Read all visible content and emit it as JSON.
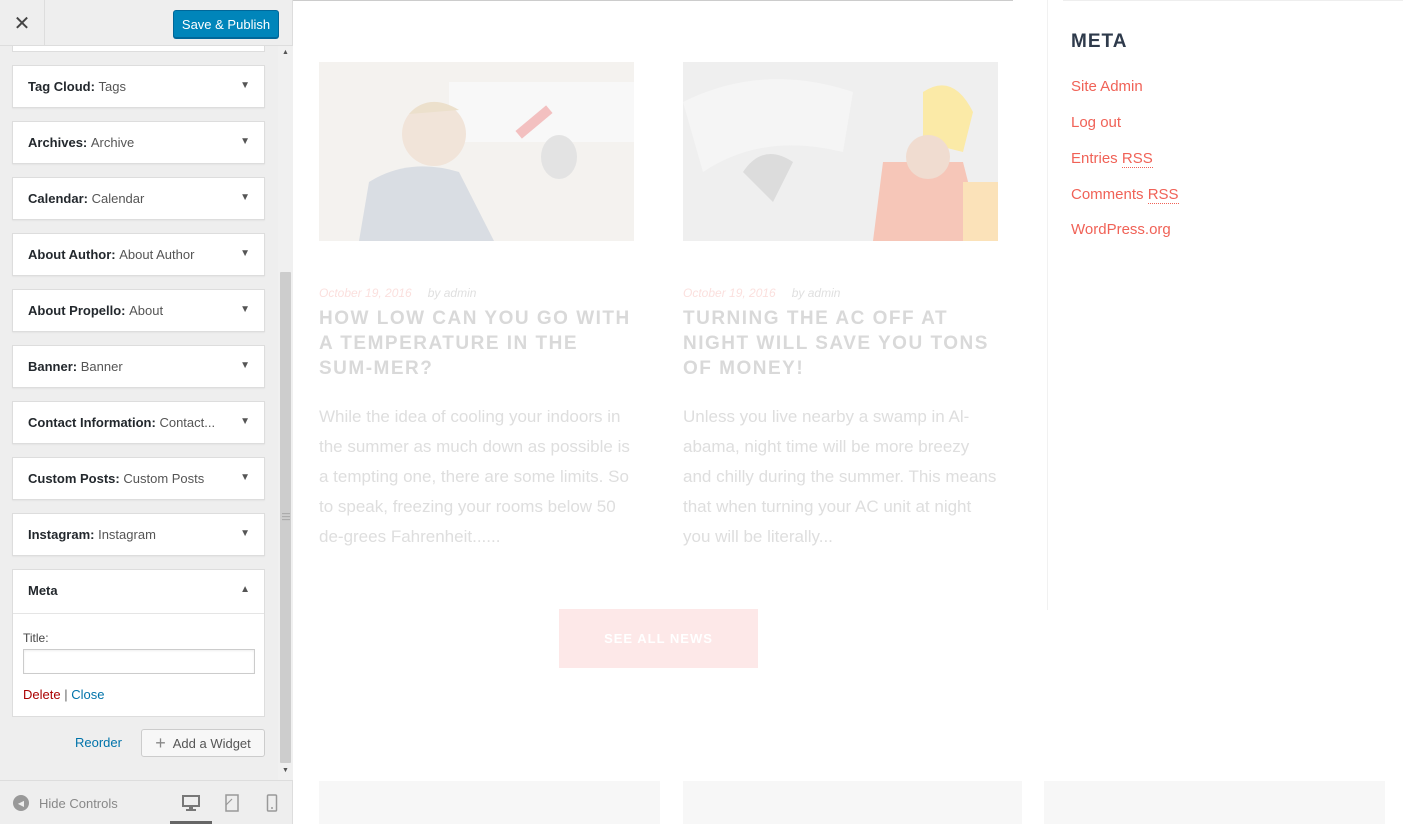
{
  "customizer": {
    "close_glyph": "✕",
    "save_label": "Save & Publish",
    "widgets": [
      {
        "name": "Tag Cloud",
        "title": "Tags"
      },
      {
        "name": "Archives",
        "title": "Archive"
      },
      {
        "name": "Calendar",
        "title": "Calendar"
      },
      {
        "name": "About Author",
        "title": "About Author"
      },
      {
        "name": "About Propello",
        "title": "About"
      },
      {
        "name": "Banner",
        "title": "Banner"
      },
      {
        "name": "Contact Information",
        "title": "Contact..."
      },
      {
        "name": "Custom Posts",
        "title": "Custom Posts"
      },
      {
        "name": "Instagram",
        "title": "Instagram"
      }
    ],
    "expanded_widget": {
      "name": "Meta",
      "title_label": "Title:",
      "title_value": "",
      "delete_label": "Delete",
      "separator": "|",
      "close_label": "Close"
    },
    "reorder_label": "Reorder",
    "add_widget_label": "Add a Widget",
    "hide_controls_label": "Hide Controls",
    "colors": {
      "primary_button": "#0085ba",
      "link": "#0073aa",
      "delete": "#a00"
    }
  },
  "preview": {
    "posts": [
      {
        "date": "October 19, 2016",
        "author": "by admin",
        "title": "HOW LOW CAN YOU GO WITH A TEMPERATURE IN THE SUM-MER?",
        "excerpt": "While the idea of cooling your indoors in the summer as much down as possible is a tempting one, there are some limits. So to speak, freezing your rooms below 50 de-grees Fahrenheit......"
      },
      {
        "date": "October 19, 2016",
        "author": "by admin",
        "title": "TURNING THE AC OFF AT NIGHT WILL SAVE YOU TONS OF MONEY!",
        "excerpt": "Unless you live nearby a swamp in Al-abama, night time will be more breezy and chilly during the summer. This means that when turning your AC unit at night you will be literally..."
      }
    ],
    "see_all_label": "SEE ALL NEWS",
    "sidebar": {
      "title": "META",
      "links": {
        "site_admin": "Site Admin",
        "log_out": "Log out",
        "entries_prefix": "Entries",
        "comments_prefix": "Comments",
        "rss": "RSS",
        "wordpress": "WordPress.org"
      }
    },
    "colors": {
      "accent": "#f06257",
      "heading": "#2e3a4b"
    }
  }
}
